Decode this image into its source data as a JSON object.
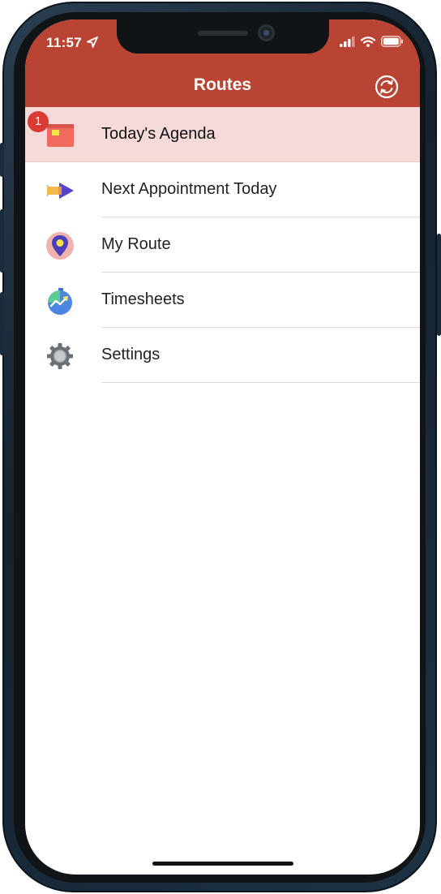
{
  "status_bar": {
    "time": "11:57",
    "icons": [
      "location-arrow-icon",
      "cellular-signal-icon",
      "wifi-icon",
      "battery-icon"
    ]
  },
  "nav": {
    "title": "Routes",
    "refresh_icon": "refresh-icon"
  },
  "menu": {
    "items": [
      {
        "label": "Today's Agenda",
        "icon": "calendar-icon",
        "badge": "1",
        "selected": true
      },
      {
        "label": "Next Appointment Today",
        "icon": "next-arrow-icon"
      },
      {
        "label": "My Route",
        "icon": "map-pin-icon"
      },
      {
        "label": "Timesheets",
        "icon": "stopwatch-icon"
      },
      {
        "label": "Settings",
        "icon": "gear-icon"
      }
    ]
  },
  "colors": {
    "header": "#b94433",
    "selected_row": "#f6dada",
    "badge": "#d83a34"
  }
}
